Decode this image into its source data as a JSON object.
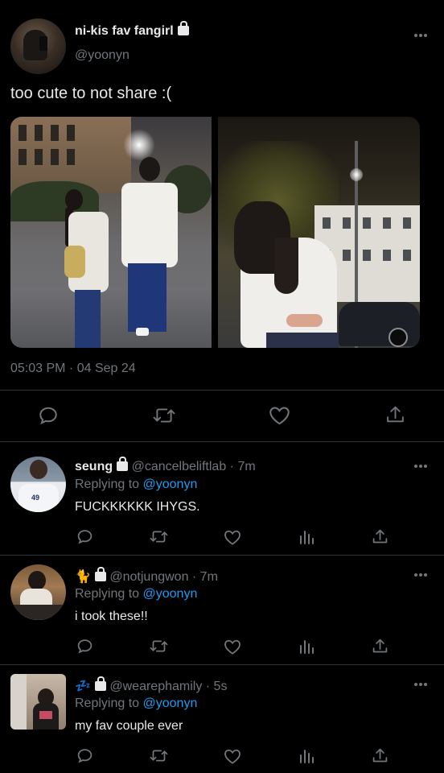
{
  "tweet": {
    "display_name": "ni-kis fav fangirl",
    "handle": "@yoonyn",
    "text": "too cute to not share :(",
    "timestamp": "05:03 PM · 04 Sep 24"
  },
  "replies": [
    {
      "display_name": "seung",
      "handle_time": "@cancelbeliftlab · 7m",
      "replying_prefix": "Replying to",
      "replying_to": "@yoonyn",
      "text": "FUCKKKKKK IHYGS."
    },
    {
      "display_name": "🐈",
      "handle_time": "@notjungwon · 7m",
      "replying_prefix": "Replying to",
      "replying_to": "@yoonyn",
      "text": "i took these!!"
    },
    {
      "display_name": "💤",
      "handle_time": "@wearephamily · 5s",
      "replying_prefix": "Replying to",
      "replying_to": "@yoonyn",
      "text": "my fav couple ever"
    }
  ],
  "colors": {
    "background": "#000000",
    "text": "#e7e9ea",
    "secondary": "#71767b",
    "link": "#1d9bf0",
    "divider": "#2f3336"
  },
  "icons": [
    "more-icon",
    "lock-icon",
    "reply-icon",
    "retweet-icon",
    "like-icon",
    "views-icon",
    "share-icon"
  ]
}
